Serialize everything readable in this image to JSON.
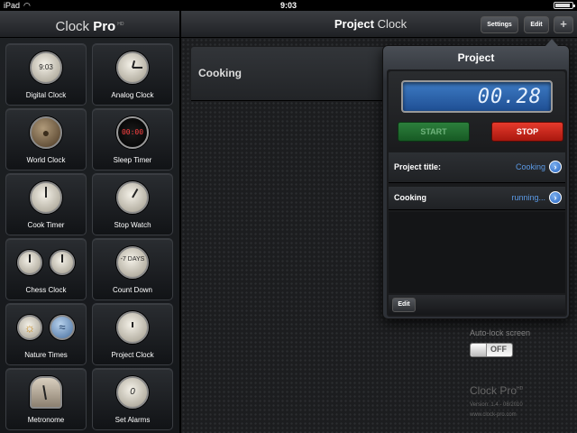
{
  "status_bar": {
    "carrier": "iPad",
    "wifi_icon": "wifi-icon",
    "time": "9:03",
    "battery_icon": "battery-icon"
  },
  "left_header": {
    "brand": "Clock",
    "brand_bold": "Pro",
    "brand_sup": "HD"
  },
  "clocks": [
    {
      "label": "Digital Clock",
      "icon": "digital-clock-icon",
      "face": "9:03"
    },
    {
      "label": "Analog Clock",
      "icon": "analog-clock-icon",
      "face": ""
    },
    {
      "label": "World Clock",
      "icon": "globe-icon",
      "face": ""
    },
    {
      "label": "Sleep Timer",
      "icon": "sleep-timer-icon",
      "face": "00:00"
    },
    {
      "label": "Cook Timer",
      "icon": "cook-timer-icon",
      "face": ""
    },
    {
      "label": "Stop Watch",
      "icon": "stopwatch-icon",
      "face": ""
    },
    {
      "label": "Chess Clock",
      "icon": "chess-clock-icon",
      "face": ""
    },
    {
      "label": "Count Down",
      "icon": "countdown-icon",
      "face": "-7 DAYS"
    },
    {
      "label": "Nature Times",
      "icon": "nature-times-icon",
      "face": ""
    },
    {
      "label": "Project Clock",
      "icon": "project-clock-icon",
      "face": ""
    },
    {
      "label": "Metronome",
      "icon": "metronome-icon",
      "face": ""
    },
    {
      "label": "Set Alarms",
      "icon": "alarm-icon",
      "face": "0"
    }
  ],
  "right_header": {
    "title_bold": "Project",
    "title_rest": "Clock",
    "settings_label": "Settings",
    "edit_label": "Edit",
    "add_label": "+"
  },
  "project_row": {
    "name": "Cooking"
  },
  "footer": {
    "autolock_label": "Auto-lock screen",
    "toggle_label": "OFF",
    "brand": "Clock Pro",
    "brand_sup": "HD",
    "version": "Version: 1.4 - 08/2010",
    "url": "www.clock-pro.com"
  },
  "popover": {
    "title": "Project",
    "timer_value": "00.28",
    "start_label": "START",
    "stop_label": "STOP",
    "project_title_label": "Project title:",
    "project_title_value": "Cooking",
    "entry_name": "Cooking",
    "entry_status": "running...",
    "edit_label": "Edit"
  },
  "colors": {
    "accent_blue": "#5b9ae6",
    "start_green": "#2c7f3c",
    "stop_red": "#e53a2c",
    "lcd_blue": "#3d7bc4"
  }
}
